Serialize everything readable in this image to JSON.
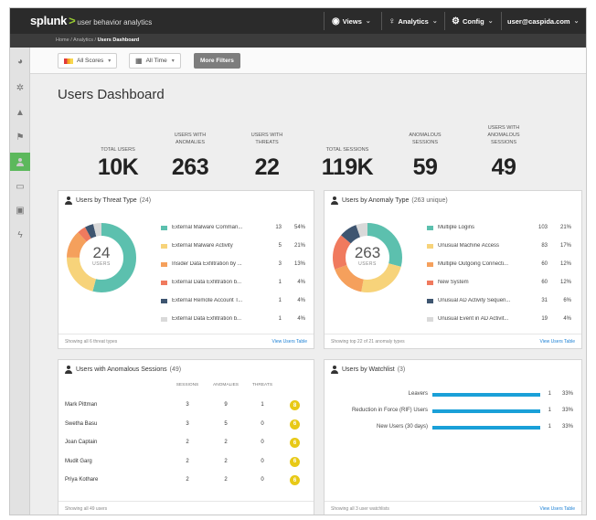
{
  "app": {
    "brand": "splunk",
    "brand_sep": ">",
    "product": "user behavior analytics"
  },
  "topnav": {
    "views": "Views",
    "analytics": "Analytics",
    "config": "Config",
    "user": "user@caspida.com"
  },
  "breadcrumb": [
    "Home",
    "Analytics",
    "Users Dashboard"
  ],
  "filters": {
    "scores": "All Scores",
    "time": "All Time",
    "more": "More Filters"
  },
  "page_title": "Users Dashboard",
  "stats": [
    {
      "label": "TOTAL USERS",
      "value": "10K"
    },
    {
      "label": "USERS WITH ANOMALIES",
      "value": "263"
    },
    {
      "label": "USERS WITH THREATS",
      "value": "22"
    },
    {
      "label": "TOTAL SESSIONS",
      "value": "119K"
    },
    {
      "label": "ANOMALOUS SESSIONS",
      "value": "59"
    },
    {
      "label": "USERS WITH ANOMALOUS SESSIONS",
      "value": "49"
    }
  ],
  "threat_panel": {
    "title": "Users by Threat Type",
    "count": "(24)",
    "center_value": "24",
    "center_label": "USERS",
    "footer_left": "Showing all 6 threat types",
    "footer_right": "View Users Table",
    "rows": [
      {
        "label": "External Malware Comman...",
        "value": "13",
        "pct": "54%",
        "color": "#5cc0ae",
        "share": 0.54
      },
      {
        "label": "External Malware Activity",
        "value": "5",
        "pct": "21%",
        "color": "#f7d37a",
        "share": 0.21
      },
      {
        "label": "Insider Data Exfiltration by ...",
        "value": "3",
        "pct": "13%",
        "color": "#f5a05c",
        "share": 0.13
      },
      {
        "label": "External Data Exfiltration b...",
        "value": "1",
        "pct": "4%",
        "color": "#f07a5e",
        "share": 0.04
      },
      {
        "label": "External Remote Account T...",
        "value": "1",
        "pct": "4%",
        "color": "#3e5570",
        "share": 0.04
      },
      {
        "label": "External Data Exfiltration b...",
        "value": "1",
        "pct": "4%",
        "color": "#d9d9d9",
        "share": 0.04
      }
    ]
  },
  "anomaly_panel": {
    "title": "Users by Anomaly Type",
    "count": "(263 unique)",
    "center_value": "263",
    "center_label": "USERS",
    "footer_left": "Showing top 22 of 21 anomaly types",
    "footer_right": "View Users Table",
    "rows": [
      {
        "label": "Multiple Logins",
        "value": "103",
        "pct": "21%",
        "color": "#5cc0ae",
        "share": 0.21
      },
      {
        "label": "Unusual Machine Access",
        "value": "83",
        "pct": "17%",
        "color": "#f7d37a",
        "share": 0.17
      },
      {
        "label": "Multiple Outgoing Connecti...",
        "value": "60",
        "pct": "12%",
        "color": "#f5a05c",
        "share": 0.12
      },
      {
        "label": "New System",
        "value": "60",
        "pct": "12%",
        "color": "#f07a5e",
        "share": 0.12
      },
      {
        "label": "Unusual AD Activity Sequen...",
        "value": "31",
        "pct": "6%",
        "color": "#3e5570",
        "share": 0.06
      },
      {
        "label": "Unusual Event in AD Activit...",
        "value": "19",
        "pct": "4%",
        "color": "#d9d9d9",
        "share": 0.04
      }
    ]
  },
  "sessions_panel": {
    "title": "Users with Anomalous Sessions",
    "count": "(49)",
    "columns": [
      "SESSIONS",
      "ANOMALIES",
      "THREATS"
    ],
    "footer_left": "Showing all 49 users",
    "rows": [
      {
        "name": "Mark Pittman",
        "sessions": "3",
        "anomalies": "9",
        "threats": "1",
        "score": "8"
      },
      {
        "name": "Swetha Basu",
        "sessions": "3",
        "anomalies": "5",
        "threats": "0",
        "score": "6"
      },
      {
        "name": "Joan Captain",
        "sessions": "2",
        "anomalies": "2",
        "threats": "0",
        "score": "6"
      },
      {
        "name": "Mudit Garg",
        "sessions": "2",
        "anomalies": "2",
        "threats": "0",
        "score": "6"
      },
      {
        "name": "Priya Kothare",
        "sessions": "2",
        "anomalies": "2",
        "threats": "0",
        "score": "6"
      }
    ]
  },
  "watchlist_panel": {
    "title": "Users by Watchlist",
    "count": "(3)",
    "footer_left": "Showing all 3 user watchlists",
    "footer_right": "View Users Table",
    "rows": [
      {
        "label": "Leavers",
        "value": "1",
        "pct": "33%",
        "share": 1.0
      },
      {
        "label": "Reduction in Force (RIF) Users",
        "value": "1",
        "pct": "33%",
        "share": 1.0
      },
      {
        "label": "New Users (30 days)",
        "value": "1",
        "pct": "33%",
        "share": 1.0
      }
    ]
  },
  "sidebar_icons": [
    "pie-chart-icon",
    "gears-icon",
    "warning-icon",
    "flag-icon",
    "user-icon",
    "devices-icon",
    "id-card-icon",
    "bolt-icon"
  ]
}
